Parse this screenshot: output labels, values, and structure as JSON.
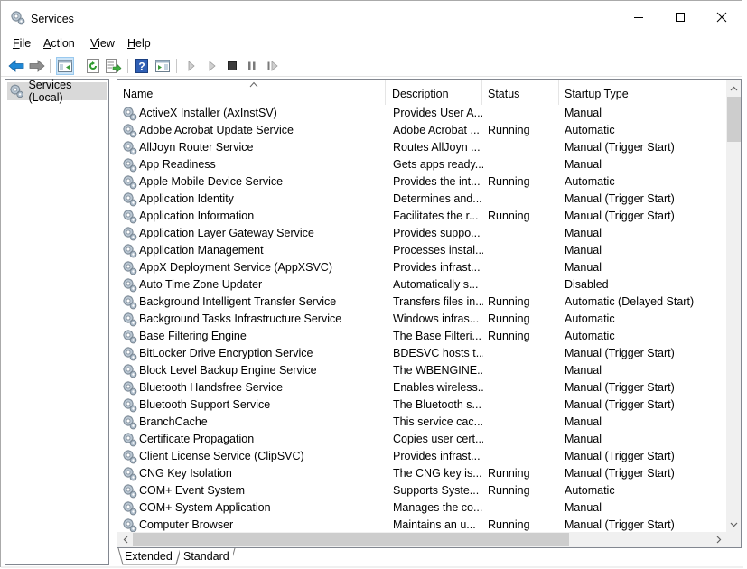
{
  "window": {
    "title": "Services",
    "icon": "gears-icon",
    "controls": {
      "minimize": "minimize-icon",
      "maximize": "maximize-icon",
      "close": "close-icon"
    }
  },
  "menu": [
    {
      "label": "File",
      "accel": "F",
      "rest": "ile"
    },
    {
      "label": "Action",
      "accel": "A",
      "rest": "ction"
    },
    {
      "label": "View",
      "accel": "V",
      "rest": "iew"
    },
    {
      "label": "Help",
      "accel": "H",
      "rest": "elp"
    }
  ],
  "toolbar": [
    {
      "name": "back-button",
      "icon": "arrow-left-icon"
    },
    {
      "name": "forward-button",
      "icon": "arrow-right-icon"
    },
    {
      "name": "show-hide-console-tree-button",
      "icon": "console-tree-icon",
      "active": true
    },
    {
      "name": "refresh-button",
      "icon": "refresh-icon"
    },
    {
      "name": "export-list-button",
      "icon": "export-icon"
    },
    {
      "name": "help-button",
      "icon": "help-icon"
    },
    {
      "name": "show-hide-action-pane-button",
      "icon": "action-pane-icon"
    },
    {
      "name": "start-service-button",
      "icon": "play-icon"
    },
    {
      "name": "start-service-alt-button",
      "icon": "play-icon"
    },
    {
      "name": "stop-service-button",
      "icon": "stop-icon"
    },
    {
      "name": "pause-service-button",
      "icon": "pause-icon"
    },
    {
      "name": "restart-service-button",
      "icon": "restart-icon"
    }
  ],
  "tree": {
    "selected": "Services (Local)"
  },
  "columns": [
    "Name",
    "Description",
    "Status",
    "Startup Type"
  ],
  "sort": {
    "column": "Name",
    "direction": "ascending"
  },
  "services": [
    {
      "name": "ActiveX Installer (AxInstSV)",
      "description": "Provides User A...",
      "status": "",
      "startup": "Manual"
    },
    {
      "name": "Adobe Acrobat Update Service",
      "description": "Adobe Acrobat ...",
      "status": "Running",
      "startup": "Automatic"
    },
    {
      "name": "AllJoyn Router Service",
      "description": "Routes AllJoyn ...",
      "status": "",
      "startup": "Manual (Trigger Start)"
    },
    {
      "name": "App Readiness",
      "description": "Gets apps ready...",
      "status": "",
      "startup": "Manual"
    },
    {
      "name": "Apple Mobile Device Service",
      "description": "Provides the int...",
      "status": "Running",
      "startup": "Automatic"
    },
    {
      "name": "Application Identity",
      "description": "Determines and...",
      "status": "",
      "startup": "Manual (Trigger Start)"
    },
    {
      "name": "Application Information",
      "description": "Facilitates the r...",
      "status": "Running",
      "startup": "Manual (Trigger Start)"
    },
    {
      "name": "Application Layer Gateway Service",
      "description": "Provides suppo...",
      "status": "",
      "startup": "Manual"
    },
    {
      "name": "Application Management",
      "description": "Processes instal...",
      "status": "",
      "startup": "Manual"
    },
    {
      "name": "AppX Deployment Service (AppXSVC)",
      "description": "Provides infrast...",
      "status": "",
      "startup": "Manual"
    },
    {
      "name": "Auto Time Zone Updater",
      "description": "Automatically s...",
      "status": "",
      "startup": "Disabled"
    },
    {
      "name": "Background Intelligent Transfer Service",
      "description": "Transfers files in...",
      "status": "Running",
      "startup": "Automatic (Delayed Start)"
    },
    {
      "name": "Background Tasks Infrastructure Service",
      "description": "Windows infras...",
      "status": "Running",
      "startup": "Automatic"
    },
    {
      "name": "Base Filtering Engine",
      "description": "The Base Filteri...",
      "status": "Running",
      "startup": "Automatic"
    },
    {
      "name": "BitLocker Drive Encryption Service",
      "description": "BDESVC hosts t...",
      "status": "",
      "startup": "Manual (Trigger Start)"
    },
    {
      "name": "Block Level Backup Engine Service",
      "description": "The WBENGINE...",
      "status": "",
      "startup": "Manual"
    },
    {
      "name": "Bluetooth Handsfree Service",
      "description": "Enables wireless...",
      "status": "",
      "startup": "Manual (Trigger Start)"
    },
    {
      "name": "Bluetooth Support Service",
      "description": "The Bluetooth s...",
      "status": "",
      "startup": "Manual (Trigger Start)"
    },
    {
      "name": "BranchCache",
      "description": "This service cac...",
      "status": "",
      "startup": "Manual"
    },
    {
      "name": "Certificate Propagation",
      "description": "Copies user cert...",
      "status": "",
      "startup": "Manual"
    },
    {
      "name": "Client License Service (ClipSVC)",
      "description": "Provides infrast...",
      "status": "",
      "startup": "Manual (Trigger Start)"
    },
    {
      "name": "CNG Key Isolation",
      "description": "The CNG key is...",
      "status": "Running",
      "startup": "Manual (Trigger Start)"
    },
    {
      "name": "COM+ Event System",
      "description": "Supports Syste...",
      "status": "Running",
      "startup": "Automatic"
    },
    {
      "name": "COM+ System Application",
      "description": "Manages the co...",
      "status": "",
      "startup": "Manual"
    },
    {
      "name": "Computer Browser",
      "description": "Maintains an u...",
      "status": "Running",
      "startup": "Manual (Trigger Start)"
    }
  ],
  "tabs": [
    {
      "label": "Extended",
      "selected": false
    },
    {
      "label": "Standard",
      "selected": true
    }
  ],
  "colors": {
    "toolbar_active_bg": "#cce4f7",
    "tree_selected_bg": "#d9d9d9",
    "scrollbar_thumb": "#cdcdcd",
    "scrollbar_track": "#f0f0f0",
    "back_arrow": "#1e88d6",
    "help_icon": "#2f5fb5"
  }
}
